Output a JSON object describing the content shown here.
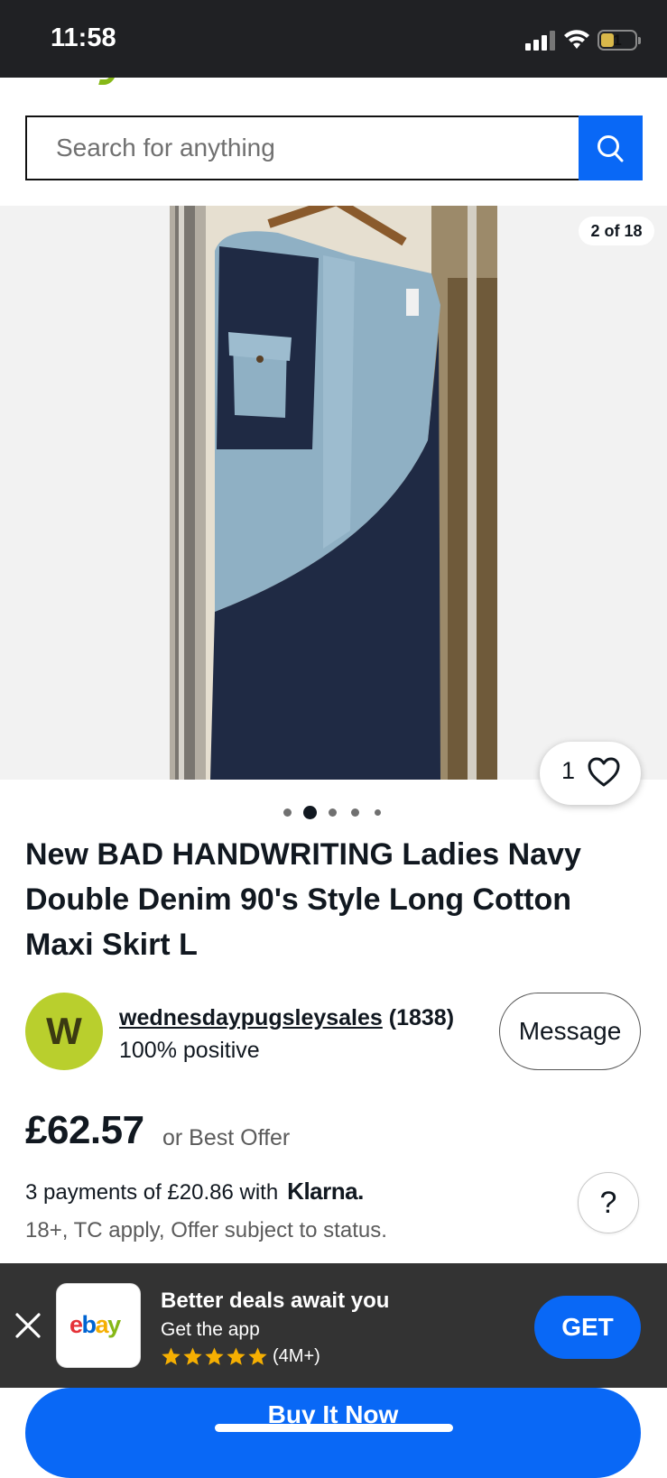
{
  "status_bar": {
    "time": "11:58",
    "battery_level": "1"
  },
  "search": {
    "placeholder": "Search for anything",
    "icon": "search-icon"
  },
  "gallery": {
    "counter": "2 of 18",
    "watch_count": "1",
    "current_index": 2,
    "dot_count": 5
  },
  "listing": {
    "title": "New BAD HANDWRITING Ladies Navy Double Denim 90's Style Long Cotton Maxi Skirt L"
  },
  "seller": {
    "initial": "W",
    "name": "wednesdaypugsleysales",
    "feedback_count": "(1838)",
    "positive": "100% positive",
    "message_label": "Message"
  },
  "price": {
    "amount": "£62.57",
    "offer_text": "or Best Offer"
  },
  "klarna": {
    "text": "3 payments of £20.86 with",
    "brand": "Klarna.",
    "terms": "18+, TC apply, Offer subject to status.",
    "help_label": "?"
  },
  "app_banner": {
    "logo_letters": [
      "e",
      "b",
      "a",
      "y"
    ],
    "title": "Better deals await you",
    "subtitle": "Get the app",
    "rating_stars": 5,
    "rating_count": "(4M+)",
    "get_label": "GET"
  },
  "buy_button": {
    "label": "Buy It Now"
  },
  "colors": {
    "accent": "#0968f6",
    "banner_bg": "#333333",
    "star": "#f5af02",
    "avatar": "#b9cf2d",
    "ebay_e": "#e53238",
    "ebay_b": "#0064d2",
    "ebay_a": "#f5af02",
    "ebay_y": "#86b817"
  }
}
